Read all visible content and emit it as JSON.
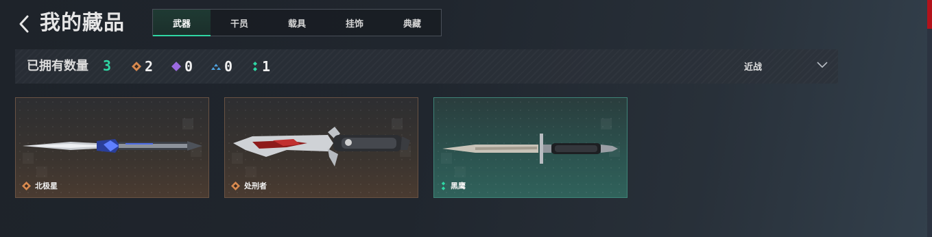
{
  "header": {
    "title": "我的藏品",
    "back_icon": "chevron-left-icon"
  },
  "tabs": [
    {
      "label": "武器",
      "active": true
    },
    {
      "label": "干员",
      "active": false
    },
    {
      "label": "载具",
      "active": false
    },
    {
      "label": "挂饰",
      "active": false
    },
    {
      "label": "典藏",
      "active": false
    }
  ],
  "summary": {
    "owned_label": "已拥有数量",
    "owned_count": "3",
    "rarities": [
      {
        "icon": "orange-diamond-icon",
        "color": "#d98a4f",
        "count": "2"
      },
      {
        "icon": "purple-diamond-icon",
        "color": "#9b6ae0",
        "count": "0"
      },
      {
        "icon": "blue-triangle-icon",
        "color": "#4fa3e0",
        "count": "0"
      },
      {
        "icon": "teal-dots-icon",
        "color": "#2fd7a4",
        "count": "1"
      }
    ]
  },
  "filter": {
    "selected": "近战",
    "icon": "chevron-down-icon"
  },
  "items": [
    {
      "name": "北极星",
      "rarity": "orange",
      "rarity_icon": "orange-diamond-icon",
      "weapon_icon": "dagger-icon"
    },
    {
      "name": "处刑者",
      "rarity": "orange",
      "rarity_icon": "orange-diamond-icon",
      "weapon_icon": "combat-knife-icon"
    },
    {
      "name": "黑鹰",
      "rarity": "teal",
      "rarity_icon": "teal-dots-icon",
      "weapon_icon": "bayonet-icon"
    }
  ],
  "colors": {
    "accent": "#2fd7a4",
    "orange_rarity": "#d98a4f",
    "teal_rarity": "#2fd7a4"
  }
}
